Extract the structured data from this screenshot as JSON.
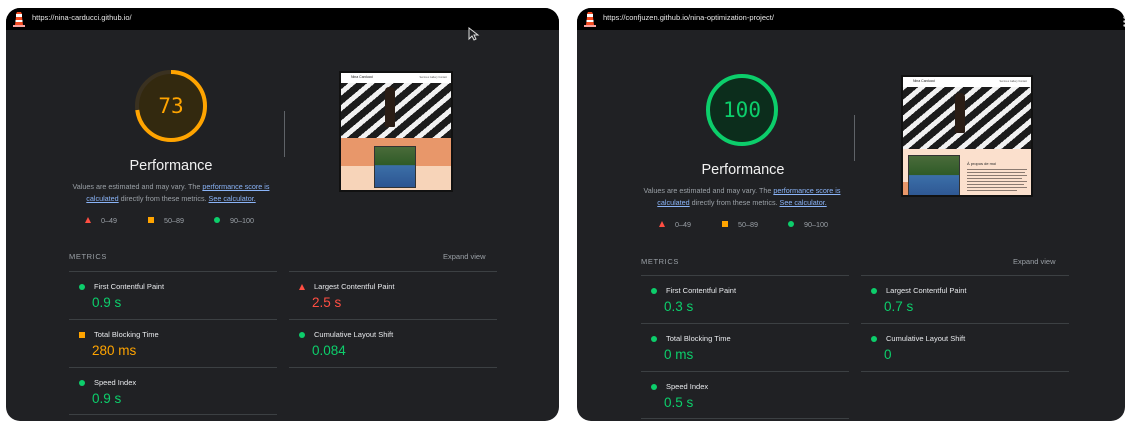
{
  "colors": {
    "pass": "#0cce6b",
    "average": "#ffa400",
    "fail": "#ff4e42",
    "background": "#202124",
    "text_secondary": "#9aa0a6"
  },
  "reports": [
    {
      "url": "https://nina-carducci.github.io/",
      "score": "73",
      "score_fraction": 0.73,
      "score_rating": "average",
      "category_title": "Performance",
      "description": {
        "before": "Values are estimated and may vary. The ",
        "link1": "performance score is calculated",
        "middle": " directly from these metrics. ",
        "link2": "See calculator."
      },
      "legend": [
        {
          "icon": "triangle-icon",
          "label": "0–49"
        },
        {
          "icon": "square-icon",
          "label": "50–89"
        },
        {
          "icon": "circle-icon",
          "label": "90–100"
        }
      ],
      "metrics_title": "METRICS",
      "expand_label": "Expand view",
      "screenshot": {
        "site_name": "Nina Carducci",
        "nav": "Services Gallery Contact",
        "heading": ""
      },
      "metrics": [
        {
          "label": "First Contentful Paint",
          "value": "0.9 s",
          "rating": "pass",
          "icon": "circle-icon"
        },
        {
          "label": "Largest Contentful Paint",
          "value": "2.5 s",
          "rating": "fail",
          "icon": "triangle-icon"
        },
        {
          "label": "Total Blocking Time",
          "value": "280 ms",
          "rating": "average",
          "icon": "square-icon"
        },
        {
          "label": "Cumulative Layout Shift",
          "value": "0.084",
          "rating": "pass",
          "icon": "circle-icon"
        },
        {
          "label": "Speed Index",
          "value": "0.9 s",
          "rating": "pass",
          "icon": "circle-icon"
        }
      ]
    },
    {
      "url": "https://confjuzen.github.io/nina-optimization-project/",
      "score": "100",
      "score_fraction": 1.0,
      "score_rating": "pass",
      "category_title": "Performance",
      "description": {
        "before": "Values are estimated and may vary. The ",
        "link1": "performance score is calculated",
        "middle": " directly from these metrics. ",
        "link2": "See calculator."
      },
      "legend": [
        {
          "icon": "triangle-icon",
          "label": "0–49"
        },
        {
          "icon": "square-icon",
          "label": "50–89"
        },
        {
          "icon": "circle-icon",
          "label": "90–100"
        }
      ],
      "metrics_title": "METRICS",
      "expand_label": "Expand view",
      "screenshot": {
        "site_name": "Nina Carducci",
        "nav": "Services Gallery Contact",
        "heading": "À propos de moi"
      },
      "metrics": [
        {
          "label": "First Contentful Paint",
          "value": "0.3 s",
          "rating": "pass",
          "icon": "circle-icon"
        },
        {
          "label": "Largest Contentful Paint",
          "value": "0.7 s",
          "rating": "pass",
          "icon": "circle-icon"
        },
        {
          "label": "Total Blocking Time",
          "value": "0 ms",
          "rating": "pass",
          "icon": "circle-icon"
        },
        {
          "label": "Cumulative Layout Shift",
          "value": "0",
          "rating": "pass",
          "icon": "circle-icon"
        },
        {
          "label": "Speed Index",
          "value": "0.5 s",
          "rating": "pass",
          "icon": "circle-icon"
        }
      ]
    }
  ]
}
